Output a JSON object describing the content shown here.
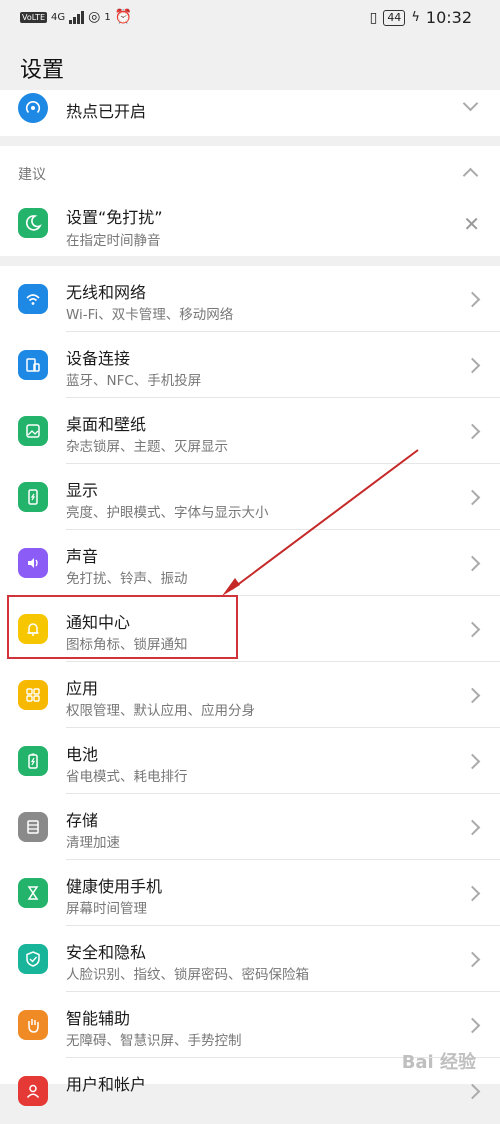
{
  "status_bar": {
    "volte": "VoLTE",
    "network": "4G",
    "hotspot_count": "1",
    "battery": "44",
    "time": "10:32"
  },
  "page_title": "设置",
  "hotspot": {
    "label": "热点已开启"
  },
  "suggestions": {
    "header": "建议",
    "item": {
      "title": "设置“免打扰”",
      "subtitle": "在指定时间静音"
    }
  },
  "settings": [
    {
      "title": "无线和网络",
      "subtitle": "Wi-Fi、双卡管理、移动网络",
      "icon": "wifi-icon",
      "color": "#1e88e5"
    },
    {
      "title": "设备连接",
      "subtitle": "蓝牙、NFC、手机投屏",
      "icon": "device-connection-icon",
      "color": "#1e88e5"
    },
    {
      "title": "桌面和壁纸",
      "subtitle": "杂志锁屏、主题、灭屏显示",
      "icon": "wallpaper-icon",
      "color": "#23b36b"
    },
    {
      "title": "显示",
      "subtitle": "亮度、护眼模式、字体与显示大小",
      "icon": "display-icon",
      "color": "#23b36b"
    },
    {
      "title": "声音",
      "subtitle": "免打扰、铃声、振动",
      "icon": "sound-icon",
      "color": "#8b5cf6"
    },
    {
      "title": "通知中心",
      "subtitle": "图标角标、锁屏通知",
      "icon": "bell-icon",
      "color": "#f6c700"
    },
    {
      "title": "应用",
      "subtitle": "权限管理、默认应用、应用分身",
      "icon": "apps-icon",
      "color": "#f6b800"
    },
    {
      "title": "电池",
      "subtitle": "省电模式、耗电排行",
      "icon": "battery-icon",
      "color": "#23b36b"
    },
    {
      "title": "存储",
      "subtitle": "清理加速",
      "icon": "storage-icon",
      "color": "#8a8a8a"
    },
    {
      "title": "健康使用手机",
      "subtitle": "屏幕时间管理",
      "icon": "hourglass-icon",
      "color": "#23b36b"
    },
    {
      "title": "安全和隐私",
      "subtitle": "人脸识别、指纹、锁屏密码、密码保险箱",
      "icon": "shield-icon",
      "color": "#18b59a"
    },
    {
      "title": "智能辅助",
      "subtitle": "无障碍、智慧识屏、手势控制",
      "icon": "hand-icon",
      "color": "#f08a24"
    },
    {
      "title": "用户和帐户",
      "subtitle": "",
      "icon": "user-icon",
      "color": "#e53935"
    }
  ],
  "watermark": "Bai 经验"
}
